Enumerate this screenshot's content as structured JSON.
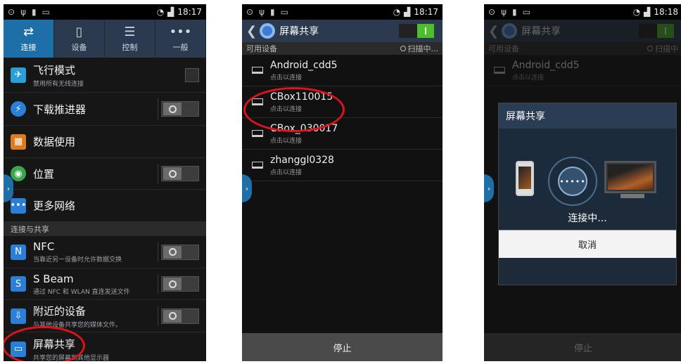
{
  "status": {
    "time_left": "18:17",
    "time_mid": "18:17",
    "time_right": "18:18"
  },
  "panel1": {
    "tabs": [
      {
        "icon": "⇄",
        "label": "连接"
      },
      {
        "icon": "▯",
        "label": "设备"
      },
      {
        "icon": "☰",
        "label": "控制"
      },
      {
        "icon": "•••",
        "label": "一般"
      }
    ],
    "rows": [
      {
        "title": "飞行模式",
        "sub": "禁用所有无线连接"
      },
      {
        "title": "下载推进器",
        "sub": ""
      },
      {
        "title": "数据使用",
        "sub": ""
      },
      {
        "title": "位置",
        "sub": ""
      },
      {
        "title": "更多网络",
        "sub": ""
      }
    ],
    "section_header": "连接与共享",
    "share_rows": [
      {
        "title": "NFC",
        "sub": "当靠近另一设备时允许数据交换"
      },
      {
        "title": "S Beam",
        "sub": "通过 NFC 和 WLAN 直连发送文件"
      },
      {
        "title": "附近的设备",
        "sub": "与其他设备共享您的媒体文件。"
      },
      {
        "title": "屏幕共享",
        "sub": "共享您的屏幕到其他显示器"
      }
    ],
    "accent": "#1e6fa8"
  },
  "panel2": {
    "title": "屏幕共享",
    "available": "可用设备",
    "scanning": "扫描中...",
    "devices": [
      {
        "name": "Android_cdd5",
        "sub": "点击以连接"
      },
      {
        "name": "CBox110015",
        "sub": "点击以连接"
      },
      {
        "name": "CBox_030017",
        "sub": "点击以连接"
      },
      {
        "name": "zhanggl0328",
        "sub": "点击以连接"
      }
    ],
    "stop": "停止"
  },
  "panel3": {
    "title": "屏幕共享",
    "available": "可用设备",
    "scanning": "扫描中",
    "device_name": "Android_cdd5",
    "device_sub": "点击以连接",
    "dialog_title": "屏幕共享",
    "dialog_status": "连接中...",
    "dialog_cancel": "取消",
    "dialog_dots": "•••••",
    "stop": "停止"
  }
}
